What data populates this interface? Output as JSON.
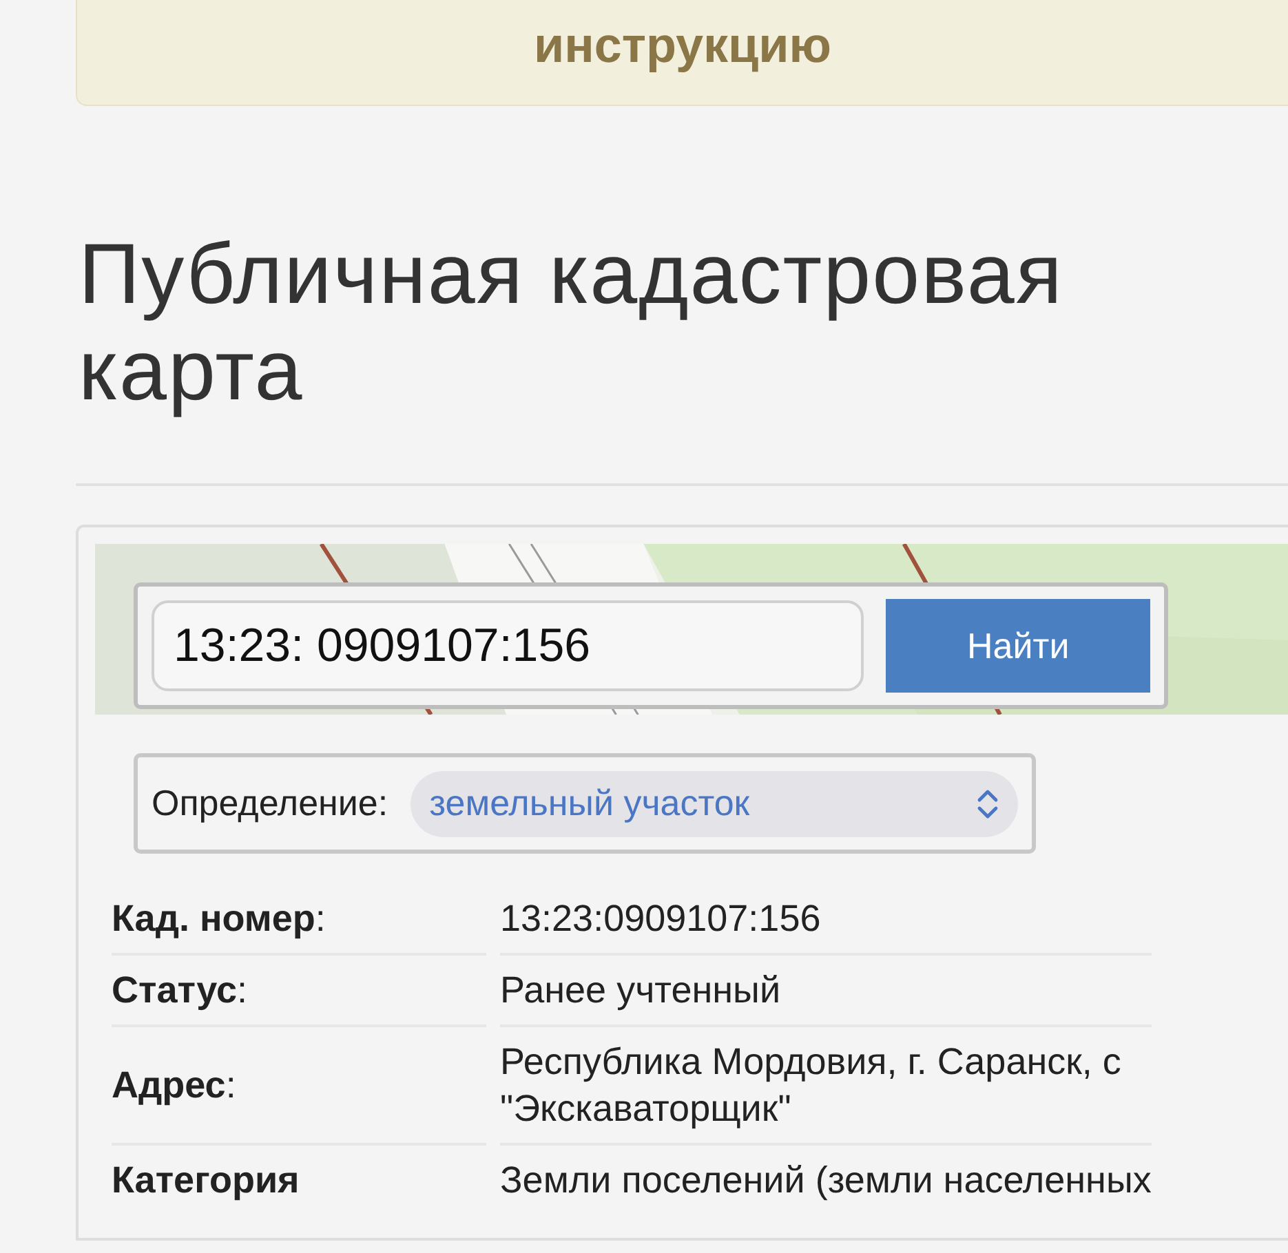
{
  "banner": {
    "text": "инструкцию"
  },
  "title": "Публичная кадастровая карта",
  "search": {
    "value": "13:23: 0909107:156",
    "button": "Найти"
  },
  "definition": {
    "label": "Определение:",
    "value": "земельный участок"
  },
  "properties": [
    {
      "label": "**Кад. номер**:",
      "value": "13:23:0909107:156"
    },
    {
      "label": "**Статус**:",
      "value": "Ранее учтенный"
    },
    {
      "label": "**Адрес**:",
      "value": "Республика Мордовия, г. Саранск, с\n\"Экскаваторщик\""
    },
    {
      "label": "**Категория**",
      "value": "Земли поселений (земли населенных"
    }
  ]
}
